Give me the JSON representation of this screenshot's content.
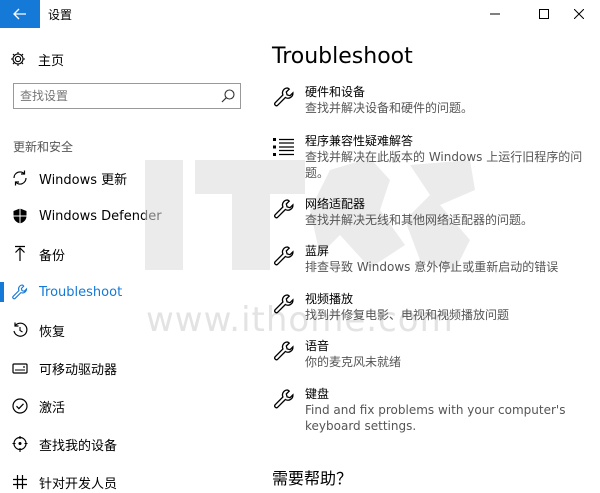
{
  "window": {
    "title": "设置"
  },
  "sidebar": {
    "home_label": "主页",
    "search": {
      "placeholder": "查找设置"
    },
    "section_title": "更新和安全",
    "items": [
      {
        "label": "Windows 更新",
        "icon": "sync-icon"
      },
      {
        "label": "Windows Defender",
        "icon": "shield-icon"
      },
      {
        "label": "备份",
        "icon": "backup-arrow-icon"
      },
      {
        "label": "Troubleshoot",
        "icon": "wrench-icon",
        "active": true
      },
      {
        "label": "恢复",
        "icon": "recovery-icon"
      },
      {
        "label": "可移动驱动器",
        "icon": "removable-drive-icon"
      },
      {
        "label": "激活",
        "icon": "activation-check-icon"
      },
      {
        "label": "查找我的设备",
        "icon": "find-device-icon"
      },
      {
        "label": "针对开发人员",
        "icon": "developer-icon"
      }
    ]
  },
  "main": {
    "title": "Troubleshoot",
    "items": [
      {
        "title": "硬件和设备",
        "desc": "查找并解决设备和硬件的问题。",
        "icon": "wrench-icon"
      },
      {
        "title": "程序兼容性疑难解答",
        "desc": "查找并解决在此版本的 Windows 上运行旧程序的问题。",
        "icon": "list-icon"
      },
      {
        "title": "网络适配器",
        "desc": "查找并解决无线和其他网络适配器的问题。",
        "icon": "wrench-icon"
      },
      {
        "title": "蓝屏",
        "desc": "排查导致 Windows 意外停止或重新启动的错误",
        "icon": "wrench-icon"
      },
      {
        "title": "视频播放",
        "desc": "找到并修复电影、电视和视频播放问题",
        "icon": "wrench-icon"
      },
      {
        "title": "语音",
        "desc": "你的麦克风未就绪",
        "icon": "wrench-icon"
      },
      {
        "title": "键盘",
        "desc": "Find and fix problems with your computer's keyboard settings.",
        "icon": "wrench-icon"
      }
    ],
    "help_title": "需要帮助？"
  },
  "watermark": {
    "big": "IT之家",
    "url": "www.ithome.com"
  },
  "colors": {
    "accent": "#1479d7",
    "secondary_text": "#555555"
  }
}
